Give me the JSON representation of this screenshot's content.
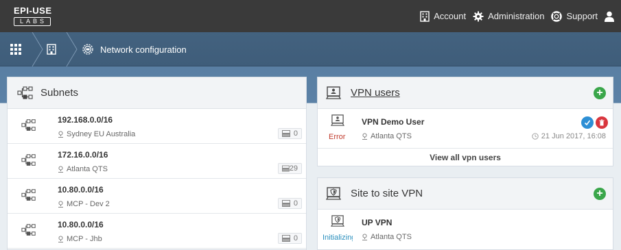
{
  "brand": {
    "logo_top": "EPI-USE",
    "logo_bottom": "LABS"
  },
  "topnav": {
    "account": "Account",
    "administration": "Administration",
    "support": "Support"
  },
  "breadcrumb": {
    "current": "Network configuration"
  },
  "subnets": {
    "title": "Subnets",
    "items": [
      {
        "cidr": "192.168.0.0/16",
        "location": "Sydney EU Australia",
        "count": "0"
      },
      {
        "cidr": "172.16.0.0/16",
        "location": "Atlanta QTS",
        "count": "29"
      },
      {
        "cidr": "10.80.0.0/16",
        "location": "MCP - Dev 2",
        "count": "0"
      },
      {
        "cidr": "10.80.0.0/16",
        "location": "MCP - Jhb",
        "count": "0"
      }
    ]
  },
  "vpn_users": {
    "title": "VPN users",
    "add_label": "+",
    "entry": {
      "name": "VPN Demo User",
      "status": "Error",
      "location": "Atlanta QTS",
      "date": "21 Jun 2017, 16:08"
    },
    "view_all": "View all vpn users"
  },
  "site_to_site": {
    "title": "Site to site VPN",
    "add_label": "+",
    "entry": {
      "name": "UP VPN",
      "status": "Initializing",
      "location": "Atlanta QTS"
    }
  },
  "colors": {
    "topbar": "#3a3a3a",
    "breadcrumb": "#43627f",
    "add": "#3aa64a",
    "confirm": "#2d8fd5",
    "delete": "#d9363e",
    "error": "#c0392b",
    "initializing": "#2a8fbd"
  },
  "icons": [
    "building-icon",
    "gear-icon",
    "lifebuoy-icon",
    "user-icon",
    "apps-grid-icon",
    "network-icon",
    "vpn-monitor-icon",
    "shield-monitor-icon",
    "location-pin-icon",
    "clock-icon",
    "server-icon",
    "check-icon",
    "trash-icon"
  ]
}
